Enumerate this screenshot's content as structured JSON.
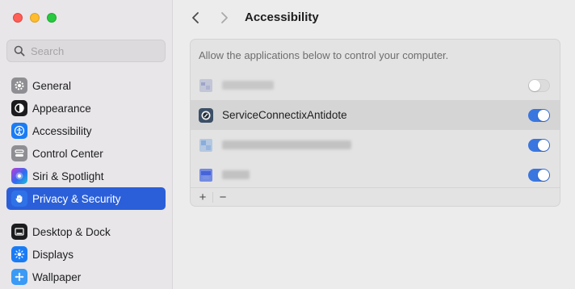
{
  "sidebar": {
    "search_placeholder": "Search",
    "items": [
      {
        "label": "General",
        "icon": "gear-icon",
        "color": "#8e8e93"
      },
      {
        "label": "Appearance",
        "icon": "appearance-icon",
        "color": "#1c1c1e"
      },
      {
        "label": "Accessibility",
        "icon": "accessibility-icon",
        "color": "#1a7cf5"
      },
      {
        "label": "Control Center",
        "icon": "control-center-icon",
        "color": "#8e8e93"
      },
      {
        "label": "Siri & Spotlight",
        "icon": "siri-icon",
        "color": "#6b3fa0"
      },
      {
        "label": "Privacy & Security",
        "icon": "hand-icon",
        "color": "#2f72e8",
        "active": true
      },
      {
        "label": "Desktop & Dock",
        "icon": "dock-icon",
        "color": "#1c1c1e"
      },
      {
        "label": "Displays",
        "icon": "displays-icon",
        "color": "#1a7cf5"
      },
      {
        "label": "Wallpaper",
        "icon": "wallpaper-icon",
        "color": "#3a9af5"
      }
    ]
  },
  "header": {
    "title": "Accessibility"
  },
  "panel": {
    "description": "Allow the applications below to control your computer.",
    "apps": [
      {
        "name": "",
        "redacted": true,
        "enabled": false
      },
      {
        "name": "ServiceConnectixAntidote",
        "redacted": false,
        "enabled": true
      },
      {
        "name": "",
        "redacted": true,
        "enabled": true
      },
      {
        "name": "",
        "redacted": true,
        "enabled": true
      }
    ],
    "add_label": "+",
    "remove_label": "−"
  },
  "colors": {
    "accent": "#2b5fd9",
    "toggle_on": "#3a76e0"
  }
}
